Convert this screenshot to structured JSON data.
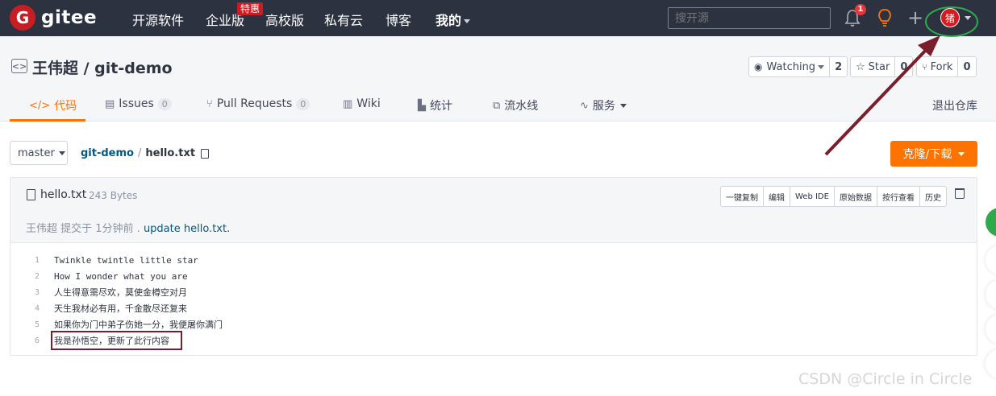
{
  "nav": {
    "logo_mark": "G",
    "logo_text": "gitee",
    "items": [
      "开源软件",
      "企业版",
      "高校版",
      "私有云",
      "博客",
      "我的"
    ],
    "hot_badge": "特惠",
    "search_placeholder": "搜开源",
    "notification_count": "1",
    "avatar_char": "猪"
  },
  "repo": {
    "title": "王伟超 / git-demo",
    "watching_label": "Watching",
    "watching_count": "2",
    "star_label": "Star",
    "star_count": "0",
    "fork_label": "Fork",
    "fork_count": "0",
    "tabs": [
      {
        "label": "代码",
        "icon": "</>"
      },
      {
        "label": "Issues",
        "count": "0"
      },
      {
        "label": "Pull Requests",
        "count": "0"
      },
      {
        "label": "Wiki"
      },
      {
        "label": "统计"
      },
      {
        "label": "流水线"
      },
      {
        "label": "服务"
      }
    ],
    "exit_label": "退出仓库"
  },
  "branch": {
    "name": "master",
    "crumb_repo": "git-demo",
    "crumb_sep": "/",
    "crumb_file": "hello.txt",
    "clone_label": "克隆/下载"
  },
  "file": {
    "name": "hello.txt",
    "size": "243 Bytes",
    "actions": [
      "一键复制",
      "编辑",
      "Web IDE",
      "原始数据",
      "按行查看",
      "历史"
    ],
    "commit_prefix": "王伟超 提交于 1分钟前 . ",
    "commit_message": "update hello.txt.",
    "lines": [
      {
        "n": "1",
        "text": "Twinkle twintle little star"
      },
      {
        "n": "2",
        "text": "How I wonder what you are"
      },
      {
        "n": "3",
        "text": "人生得意需尽欢，莫使金樽空对月"
      },
      {
        "n": "4",
        "text": "天生我材必有用，千金散尽还复来"
      },
      {
        "n": "5",
        "text": "如果你为门中弟子伤她一分，我便屠你满门"
      },
      {
        "n": "6",
        "text": "我是孙悟空，更新了此行内容"
      }
    ]
  },
  "watermark": "CSDN @Circle in Circle",
  "colors": {
    "nav_bg": "#2d3240",
    "accent": "#fe7300",
    "brand_red": "#c71d23",
    "link": "#005980",
    "annotation_arrow": "#7b1e2b",
    "annotation_circle": "#2faa4a"
  }
}
